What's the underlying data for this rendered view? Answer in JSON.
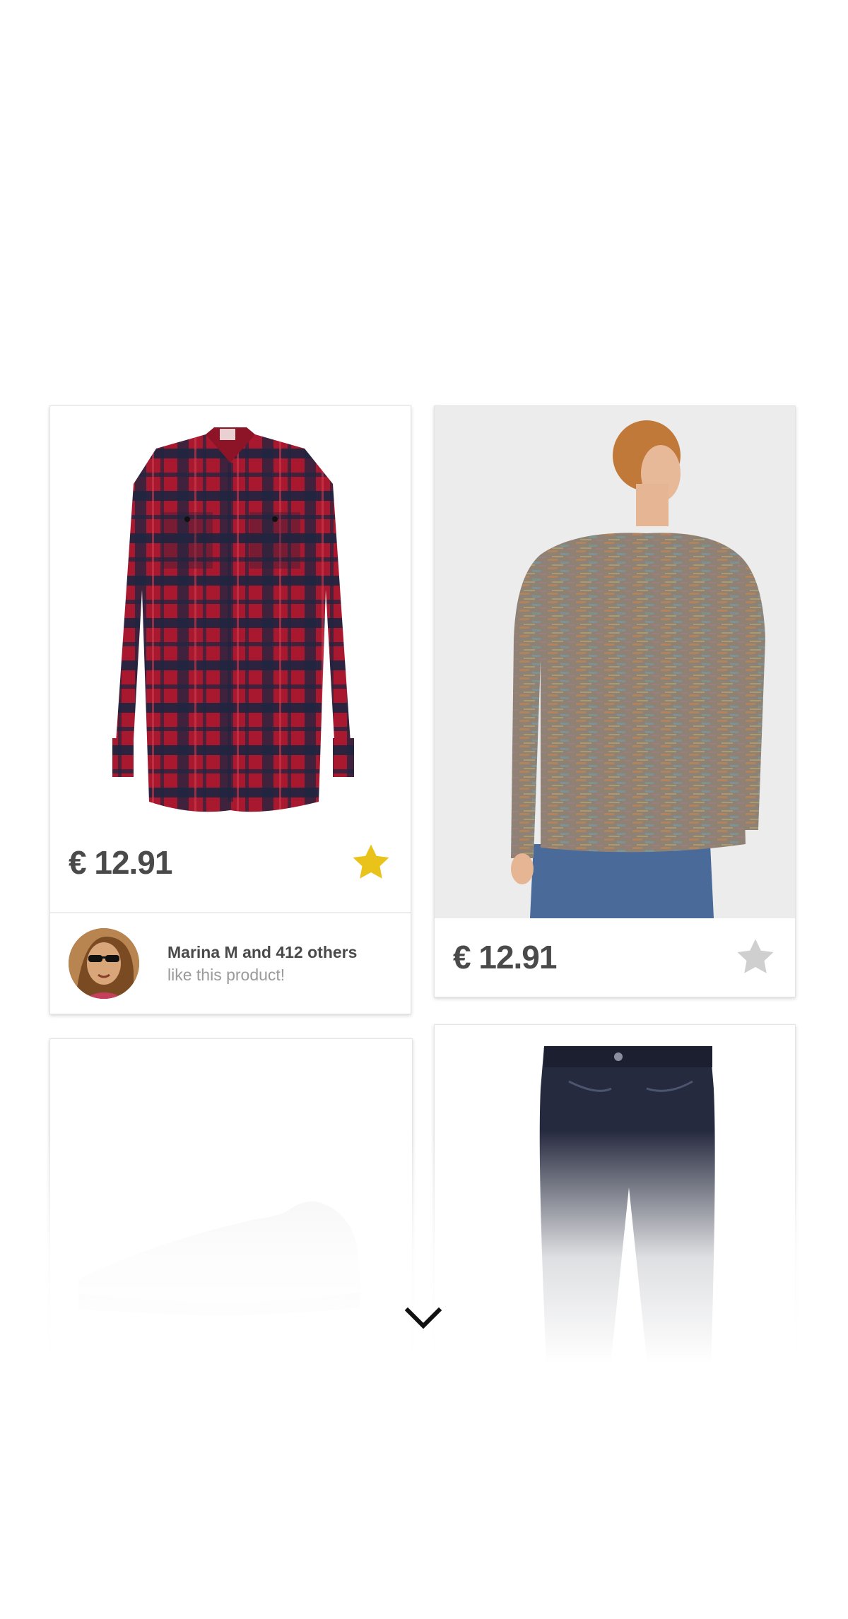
{
  "products": [
    {
      "id_label": "shirt",
      "name": "red-checked-flannel-shirt",
      "price": "€ 12.91",
      "favorited": true,
      "social": {
        "line1": "Marina M and 412 others",
        "line2": "like this product!"
      }
    },
    {
      "id_label": "sweater",
      "name": "multicolor-knit-sweater",
      "price": "€ 12.91",
      "favorited": false
    },
    {
      "id_label": "sneaker",
      "name": "white-sneaker"
    },
    {
      "id_label": "jeans",
      "name": "dark-denim-jeans"
    }
  ],
  "icons": {
    "star_active": "star-icon",
    "star_inactive": "star-icon",
    "scroll": "chevron-down-icon"
  },
  "colors": {
    "price_text": "#4a4a4a",
    "star_active": "#e9c31a",
    "star_inactive": "#cfcfcf",
    "social_primary": "#4a4a4a",
    "social_secondary": "#9a9a9a",
    "shirt_red": "#a8182e",
    "shirt_navy": "#1f2540"
  }
}
